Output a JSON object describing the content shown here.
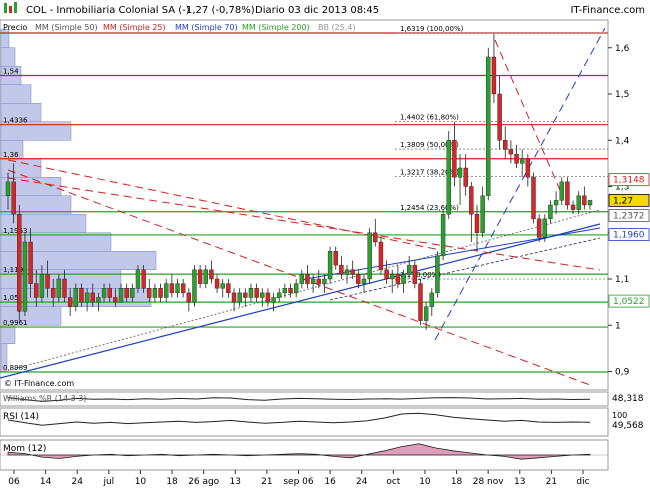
{
  "header": {
    "title": "COL - Inmobiliaria Colonial SA (-)",
    "price_change": "1,27 (-0,78%)",
    "period": "Diario",
    "datetime": "03 dic 2013 08:45",
    "brand": "IT-Finance.com",
    "legend_price": "Precio",
    "legend_ma50": "MM (Simple 50)",
    "legend_ma25": "MM (Simple 25)",
    "legend_ma70": "MM (Simple 70)",
    "legend_ma200": "MM (Simple 200)",
    "legend_bb": "BB (25,4)"
  },
  "footer": {
    "copyright": "© IT-Finance.com"
  },
  "colors": {
    "up": "#2ca02c",
    "down": "#d62728",
    "ma_dashed": "#222266",
    "ma_red": "#cc2222",
    "ma_blue": "#1f3fbf",
    "ma_green": "#2aa02a",
    "volume_profile": "#9aa4dc",
    "current_price_bg": "#f5d800"
  },
  "chart_data": [
    {
      "type": "candlestick",
      "title": "COL - Inmobiliaria Colonial SA (-)",
      "ylim": [
        0.86,
        1.66
      ],
      "y_ticks": [
        "0,9",
        "1",
        "1,1",
        "1,2",
        "1,3",
        "1,4",
        "1,5",
        "1,6"
      ],
      "x_labels": [
        "06",
        "14",
        "24",
        "jul",
        "10",
        "18",
        "26 ago",
        "13",
        "21",
        "sep 06",
        "16",
        "24",
        "oct",
        "10",
        "18",
        "28 nov",
        "13",
        "21",
        "dic"
      ],
      "price_tags": [
        {
          "label": "1,3148",
          "value": 1.3148,
          "color": "#cc2222"
        },
        {
          "label": "1,27",
          "value": 1.27,
          "color": "#000000",
          "current": true
        },
        {
          "label": "1,2372",
          "value": 1.2372,
          "color": "#555555"
        },
        {
          "label": "1,1960",
          "value": 1.196,
          "color": "#1f3fbf"
        },
        {
          "label": "1,0522",
          "value": 1.0522,
          "color": "#2aa02a"
        }
      ],
      "horizontal_levels": [
        {
          "label": "1,54",
          "value": 1.54,
          "color": "#cc2222"
        },
        {
          "label": "1,4336",
          "value": 1.4336,
          "color": "#cc2222"
        },
        {
          "label": "1,36",
          "value": 1.36,
          "color": "#cc2222"
        },
        {
          "label": "1,1953",
          "value": 1.1953,
          "color": "#2aa02a"
        },
        {
          "label": "1,1105",
          "value": 1.1105,
          "color": "#2aa02a"
        },
        {
          "label": "1,05",
          "value": 1.05,
          "color": "#2aa02a"
        },
        {
          "label": "0,9961",
          "value": 0.9961,
          "color": "#2aa02a"
        },
        {
          "label": "0,8989",
          "value": 0.8989,
          "color": "#2aa02a"
        },
        {
          "label": "1,6319 (100,00%)",
          "value": 1.6319,
          "color": "#cc2222"
        },
        {
          "label": "1,2454 (23,60%)",
          "value": 1.2454,
          "color": "#2aa02a"
        }
      ],
      "fibonacci": [
        {
          "label": "1,6319 (100,00%)",
          "value": 1.6319
        },
        {
          "label": "1,4402 (61,80%)",
          "value": 1.4402
        },
        {
          "label": "1,3809 (50,00%)",
          "value": 1.3809
        },
        {
          "label": "1,3217 (38,20%)",
          "value": 1.3217
        },
        {
          "label": "1,2454 (23,60%)",
          "value": 1.2454
        },
        {
          "label": "1,1 (0,00%)",
          "value": 1.1
        }
      ],
      "candles": [
        [
          1.28,
          1.33,
          1.25,
          1.31
        ],
        [
          1.31,
          1.35,
          1.22,
          1.24
        ],
        [
          1.24,
          1.26,
          1.01,
          1.03
        ],
        [
          1.03,
          1.2,
          1.02,
          1.18
        ],
        [
          1.18,
          1.21,
          1.06,
          1.09
        ],
        [
          1.09,
          1.12,
          1.04,
          1.06
        ],
        [
          1.06,
          1.13,
          1.05,
          1.11
        ],
        [
          1.11,
          1.14,
          1.06,
          1.08
        ],
        [
          1.08,
          1.1,
          1.04,
          1.06
        ],
        [
          1.06,
          1.11,
          1.05,
          1.1
        ],
        [
          1.1,
          1.12,
          1.05,
          1.06
        ],
        [
          1.06,
          1.08,
          1.02,
          1.04
        ],
        [
          1.04,
          1.09,
          1.03,
          1.08
        ],
        [
          1.08,
          1.09,
          1.04,
          1.05
        ],
        [
          1.05,
          1.08,
          1.03,
          1.07
        ],
        [
          1.07,
          1.09,
          1.04,
          1.05
        ],
        [
          1.05,
          1.07,
          1.03,
          1.06
        ],
        [
          1.06,
          1.09,
          1.05,
          1.08
        ],
        [
          1.08,
          1.09,
          1.05,
          1.06
        ],
        [
          1.06,
          1.08,
          1.04,
          1.05
        ],
        [
          1.05,
          1.09,
          1.05,
          1.08
        ],
        [
          1.08,
          1.09,
          1.05,
          1.06
        ],
        [
          1.06,
          1.09,
          1.05,
          1.08
        ],
        [
          1.08,
          1.13,
          1.07,
          1.12
        ],
        [
          1.12,
          1.13,
          1.07,
          1.08
        ],
        [
          1.08,
          1.1,
          1.05,
          1.06
        ],
        [
          1.06,
          1.09,
          1.05,
          1.08
        ],
        [
          1.08,
          1.09,
          1.05,
          1.06
        ],
        [
          1.06,
          1.1,
          1.05,
          1.09
        ],
        [
          1.09,
          1.11,
          1.06,
          1.07
        ],
        [
          1.07,
          1.1,
          1.06,
          1.09
        ],
        [
          1.09,
          1.1,
          1.06,
          1.07
        ],
        [
          1.07,
          1.08,
          1.03,
          1.05
        ],
        [
          1.05,
          1.13,
          1.04,
          1.12
        ],
        [
          1.12,
          1.13,
          1.08,
          1.09
        ],
        [
          1.09,
          1.13,
          1.08,
          1.12
        ],
        [
          1.12,
          1.14,
          1.09,
          1.1
        ],
        [
          1.1,
          1.11,
          1.07,
          1.08
        ],
        [
          1.08,
          1.1,
          1.06,
          1.09
        ],
        [
          1.09,
          1.1,
          1.06,
          1.07
        ],
        [
          1.07,
          1.08,
          1.03,
          1.05
        ],
        [
          1.05,
          1.08,
          1.04,
          1.07
        ],
        [
          1.07,
          1.08,
          1.04,
          1.06
        ],
        [
          1.06,
          1.09,
          1.05,
          1.08
        ],
        [
          1.08,
          1.09,
          1.05,
          1.06
        ],
        [
          1.06,
          1.08,
          1.04,
          1.07
        ],
        [
          1.07,
          1.08,
          1.04,
          1.05
        ],
        [
          1.05,
          1.07,
          1.03,
          1.06
        ],
        [
          1.06,
          1.08,
          1.05,
          1.07
        ],
        [
          1.07,
          1.09,
          1.06,
          1.08
        ],
        [
          1.08,
          1.09,
          1.06,
          1.07
        ],
        [
          1.07,
          1.1,
          1.06,
          1.09
        ],
        [
          1.09,
          1.12,
          1.08,
          1.11
        ],
        [
          1.11,
          1.13,
          1.08,
          1.09
        ],
        [
          1.09,
          1.11,
          1.07,
          1.1
        ],
        [
          1.1,
          1.12,
          1.08,
          1.09
        ],
        [
          1.09,
          1.11,
          1.07,
          1.1
        ],
        [
          1.1,
          1.17,
          1.09,
          1.16
        ],
        [
          1.16,
          1.17,
          1.12,
          1.13
        ],
        [
          1.13,
          1.15,
          1.1,
          1.11
        ],
        [
          1.11,
          1.13,
          1.09,
          1.12
        ],
        [
          1.12,
          1.14,
          1.1,
          1.11
        ],
        [
          1.11,
          1.12,
          1.08,
          1.09
        ],
        [
          1.09,
          1.11,
          1.07,
          1.1
        ],
        [
          1.1,
          1.21,
          1.09,
          1.2
        ],
        [
          1.2,
          1.23,
          1.17,
          1.18
        ],
        [
          1.18,
          1.19,
          1.11,
          1.12
        ],
        [
          1.12,
          1.14,
          1.09,
          1.1
        ],
        [
          1.1,
          1.12,
          1.07,
          1.11
        ],
        [
          1.11,
          1.13,
          1.08,
          1.09
        ],
        [
          1.09,
          1.12,
          1.07,
          1.11
        ],
        [
          1.11,
          1.15,
          1.1,
          1.13
        ],
        [
          1.13,
          1.14,
          1.08,
          1.09
        ],
        [
          1.09,
          1.1,
          1.0,
          1.01
        ],
        [
          1.01,
          1.05,
          0.99,
          1.04
        ],
        [
          1.04,
          1.08,
          1.02,
          1.07
        ],
        [
          1.07,
          1.16,
          1.06,
          1.15
        ],
        [
          1.15,
          1.25,
          1.14,
          1.24
        ],
        [
          1.24,
          1.42,
          1.23,
          1.4
        ],
        [
          1.4,
          1.44,
          1.3,
          1.32
        ],
        [
          1.32,
          1.37,
          1.26,
          1.34
        ],
        [
          1.34,
          1.37,
          1.28,
          1.3
        ],
        [
          1.3,
          1.31,
          1.18,
          1.24
        ],
        [
          1.24,
          1.26,
          1.16,
          1.2
        ],
        [
          1.2,
          1.3,
          1.19,
          1.28
        ],
        [
          1.28,
          1.6,
          1.27,
          1.58
        ],
        [
          1.58,
          1.63,
          1.48,
          1.5
        ],
        [
          1.5,
          1.54,
          1.38,
          1.4
        ],
        [
          1.4,
          1.43,
          1.36,
          1.38
        ],
        [
          1.38,
          1.4,
          1.35,
          1.37
        ],
        [
          1.37,
          1.39,
          1.34,
          1.35
        ],
        [
          1.35,
          1.38,
          1.32,
          1.36
        ],
        [
          1.36,
          1.37,
          1.3,
          1.32
        ],
        [
          1.32,
          1.33,
          1.22,
          1.23
        ],
        [
          1.23,
          1.24,
          1.18,
          1.19
        ],
        [
          1.19,
          1.24,
          1.18,
          1.23
        ],
        [
          1.23,
          1.27,
          1.22,
          1.26
        ],
        [
          1.26,
          1.29,
          1.24,
          1.27
        ],
        [
          1.27,
          1.32,
          1.26,
          1.31
        ],
        [
          1.31,
          1.32,
          1.25,
          1.26
        ],
        [
          1.26,
          1.27,
          1.24,
          1.25
        ],
        [
          1.25,
          1.29,
          1.24,
          1.28
        ],
        [
          1.28,
          1.3,
          1.25,
          1.26
        ],
        [
          1.26,
          1.27,
          1.25,
          1.27
        ]
      ]
    },
    {
      "type": "line",
      "title": "Williams %R (14 3 3)",
      "value_label": "48,318",
      "y_ticks": [
        "100"
      ],
      "values": [
        62,
        45,
        30,
        40,
        55,
        48,
        50,
        45,
        52,
        48,
        55,
        50,
        60,
        58,
        45,
        40,
        50,
        55,
        52,
        48,
        46,
        50,
        52,
        49,
        55,
        60,
        62,
        58,
        50,
        52,
        55,
        48,
        50,
        46,
        48
      ]
    },
    {
      "type": "line",
      "title": "RSI (14)",
      "value_label": "49,568",
      "y_ticks": [
        "100"
      ],
      "values": [
        55,
        48,
        42,
        46,
        50,
        47,
        49,
        46,
        48,
        50,
        52,
        49,
        51,
        54,
        50,
        47,
        49,
        52,
        50,
        48,
        50,
        53,
        60,
        70,
        72,
        68,
        62,
        58,
        55,
        52,
        54,
        50,
        49,
        50,
        49.6
      ]
    },
    {
      "type": "area",
      "title": "Mom (12)",
      "values": [
        0.04,
        0.02,
        -0.03,
        -0.05,
        -0.02,
        0.0,
        0.01,
        -0.01,
        0.0,
        0.01,
        -0.01,
        0.0,
        0.01,
        0.0,
        -0.01,
        0.0,
        0.01,
        0.02,
        0.01,
        -0.02,
        -0.04,
        0.01,
        0.06,
        0.12,
        0.16,
        0.1,
        0.06,
        0.03,
        0.0,
        -0.02,
        -0.06,
        -0.04,
        -0.02,
        0.0,
        0.01
      ]
    }
  ]
}
